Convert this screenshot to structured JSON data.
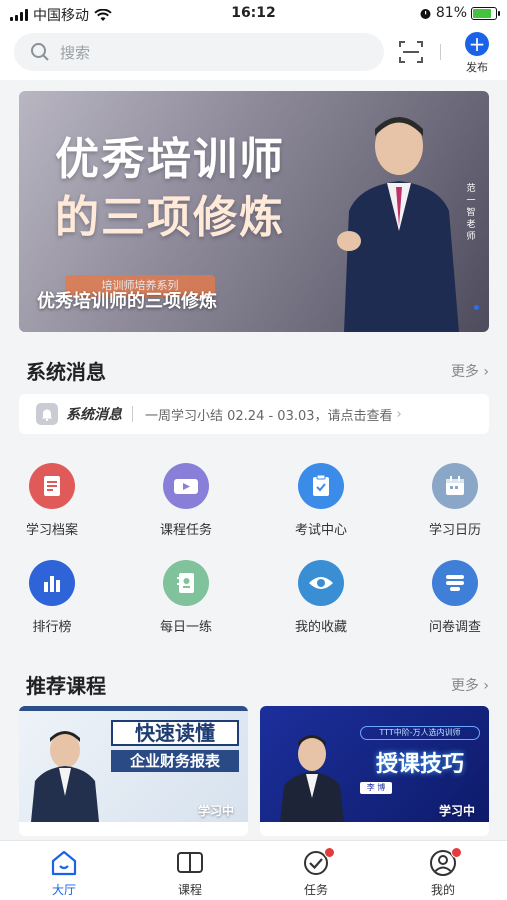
{
  "status_bar": {
    "carrier": "中国移动",
    "time": "16:12",
    "battery": "81%",
    "battery_level": 0.81
  },
  "search": {
    "placeholder": "搜索"
  },
  "topbar": {
    "publish_label": "发布"
  },
  "banner": {
    "headline_line1": "优秀培训师",
    "headline_line2": "的三项修炼",
    "series_tag": "培训师培养系列",
    "caption": "优秀培训师的三项修炼",
    "vertical_text": "范一智老师"
  },
  "system_messages": {
    "title": "系统消息",
    "more": "更多",
    "notice_label": "系统消息",
    "notice_text": "一周学习小结 02.24 - 03.03，请点击查看"
  },
  "quick_entries": [
    {
      "label": "学习档案",
      "icon": "document-icon",
      "color": "#e15a5a"
    },
    {
      "label": "课程任务",
      "icon": "video-icon",
      "color": "#8a7fd8"
    },
    {
      "label": "考试中心",
      "icon": "clipboard-check-icon",
      "color": "#3b8ce8"
    },
    {
      "label": "学习日历",
      "icon": "calendar-icon",
      "color": "#8aa7c8"
    },
    {
      "label": "排行榜",
      "icon": "bar-chart-icon",
      "color": "#2f63d8"
    },
    {
      "label": "每日一练",
      "icon": "notebook-icon",
      "color": "#7fc29b"
    },
    {
      "label": "我的收藏",
      "icon": "eye-icon",
      "color": "#3a8fd4"
    },
    {
      "label": "问卷调查",
      "icon": "survey-icon",
      "color": "#3f7fd8"
    }
  ],
  "recommended": {
    "title": "推荐课程",
    "more": "更多",
    "courses": [
      {
        "thumb_title_1": "快速读懂",
        "thumb_title_2": "企业财务报表",
        "status": "学习中"
      },
      {
        "thumb_badge": "TTT中阶-万人选内训师",
        "thumb_title_1": "授课技巧",
        "presenter": "李 博",
        "status": "学习中"
      }
    ]
  },
  "tabbar": {
    "items": [
      {
        "label": "大厅",
        "icon": "home-icon",
        "active": true
      },
      {
        "label": "课程",
        "icon": "book-icon",
        "active": false
      },
      {
        "label": "任务",
        "icon": "task-check-icon",
        "active": false
      },
      {
        "label": "我的",
        "icon": "profile-icon",
        "active": false
      }
    ]
  }
}
